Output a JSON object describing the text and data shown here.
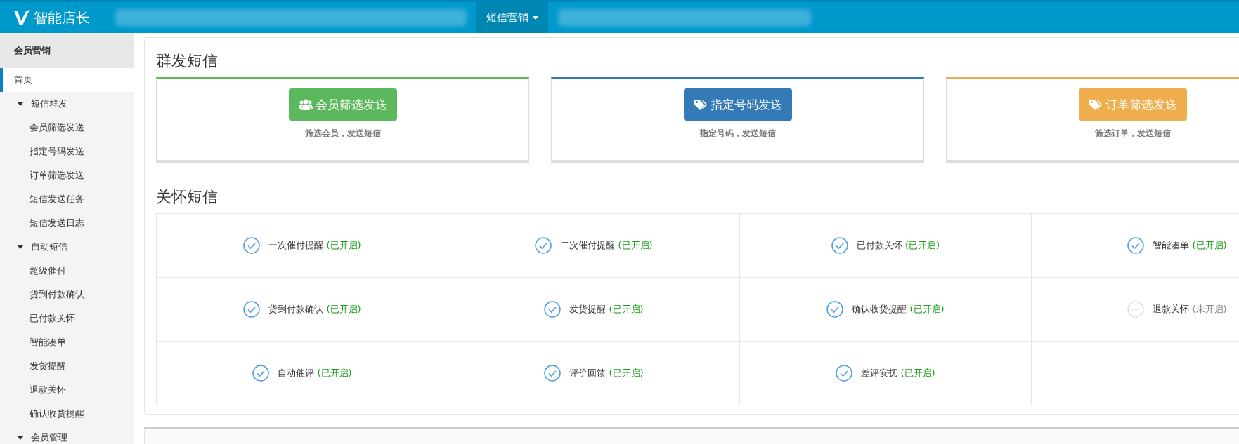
{
  "topbar": {
    "logo": "智能店长",
    "nav": [
      {
        "label": "短信营销",
        "selected": true
      }
    ]
  },
  "sidebar": {
    "title": "会员营销",
    "items": [
      {
        "label": "首页",
        "selected": true
      },
      {
        "label": "短信群发",
        "selected": false,
        "expanded": true,
        "children": [
          {
            "label": "会员筛选发送",
            "selected": false
          },
          {
            "label": "指定号码发送",
            "selected": false
          },
          {
            "label": "订单筛选发送",
            "selected": false
          },
          {
            "label": "短信发送任务",
            "selected": false
          },
          {
            "label": "短信发送日志",
            "selected": false
          }
        ]
      },
      {
        "label": "自动短信",
        "selected": false,
        "expanded": true,
        "children": [
          {
            "label": "超级催付",
            "selected": false
          },
          {
            "label": "货到付款确认",
            "selected": false
          },
          {
            "label": "已付款关怀",
            "selected": false
          },
          {
            "label": "智能凑单",
            "selected": false
          },
          {
            "label": "发货提醒",
            "selected": false
          },
          {
            "label": "退款关怀",
            "selected": false
          },
          {
            "label": "确认收货提醒",
            "selected": false
          }
        ]
      },
      {
        "label": "会员管理",
        "selected": false,
        "expanded": true
      }
    ]
  },
  "mass_sms": {
    "title": "群发短信",
    "cards": [
      {
        "button": "会员筛选发送",
        "kind": "users",
        "color": "#5cb85c",
        "description": "筛选会员，发送短信"
      },
      {
        "button": "指定号码发送",
        "kind": "tag",
        "color": "#337ab7",
        "description": "指定号码，发送短信"
      },
      {
        "button": "订单筛选发送",
        "kind": "tag",
        "color": "#f0ad4e",
        "description": "筛选订单，发送短信"
      }
    ]
  },
  "care_sms": {
    "title": "关怀短信",
    "items": [
      {
        "name": "一次催付提醒",
        "status": "(已开启)",
        "on": true
      },
      {
        "name": "二次催付提醒",
        "status": "(已开启)",
        "on": true
      },
      {
        "name": "已付款关怀",
        "status": "(已开启)",
        "on": true
      },
      {
        "name": "智能凑单",
        "status": "(已开启)",
        "on": true
      },
      {
        "name": "货到付款确认",
        "status": "(已开启)",
        "on": true
      },
      {
        "name": "发货提醒",
        "status": "(已开启)",
        "on": true
      },
      {
        "name": "确认收货提醒",
        "status": "(已开启)",
        "on": true
      },
      {
        "name": "退款关怀",
        "status": "(未开启)",
        "on": false
      },
      {
        "name": "自动催评",
        "status": "(已开启)",
        "on": true
      },
      {
        "name": "评价回馈",
        "status": "(已开启)",
        "on": true
      },
      {
        "name": "差评安抚",
        "status": "(已开启)",
        "on": true
      }
    ]
  }
}
